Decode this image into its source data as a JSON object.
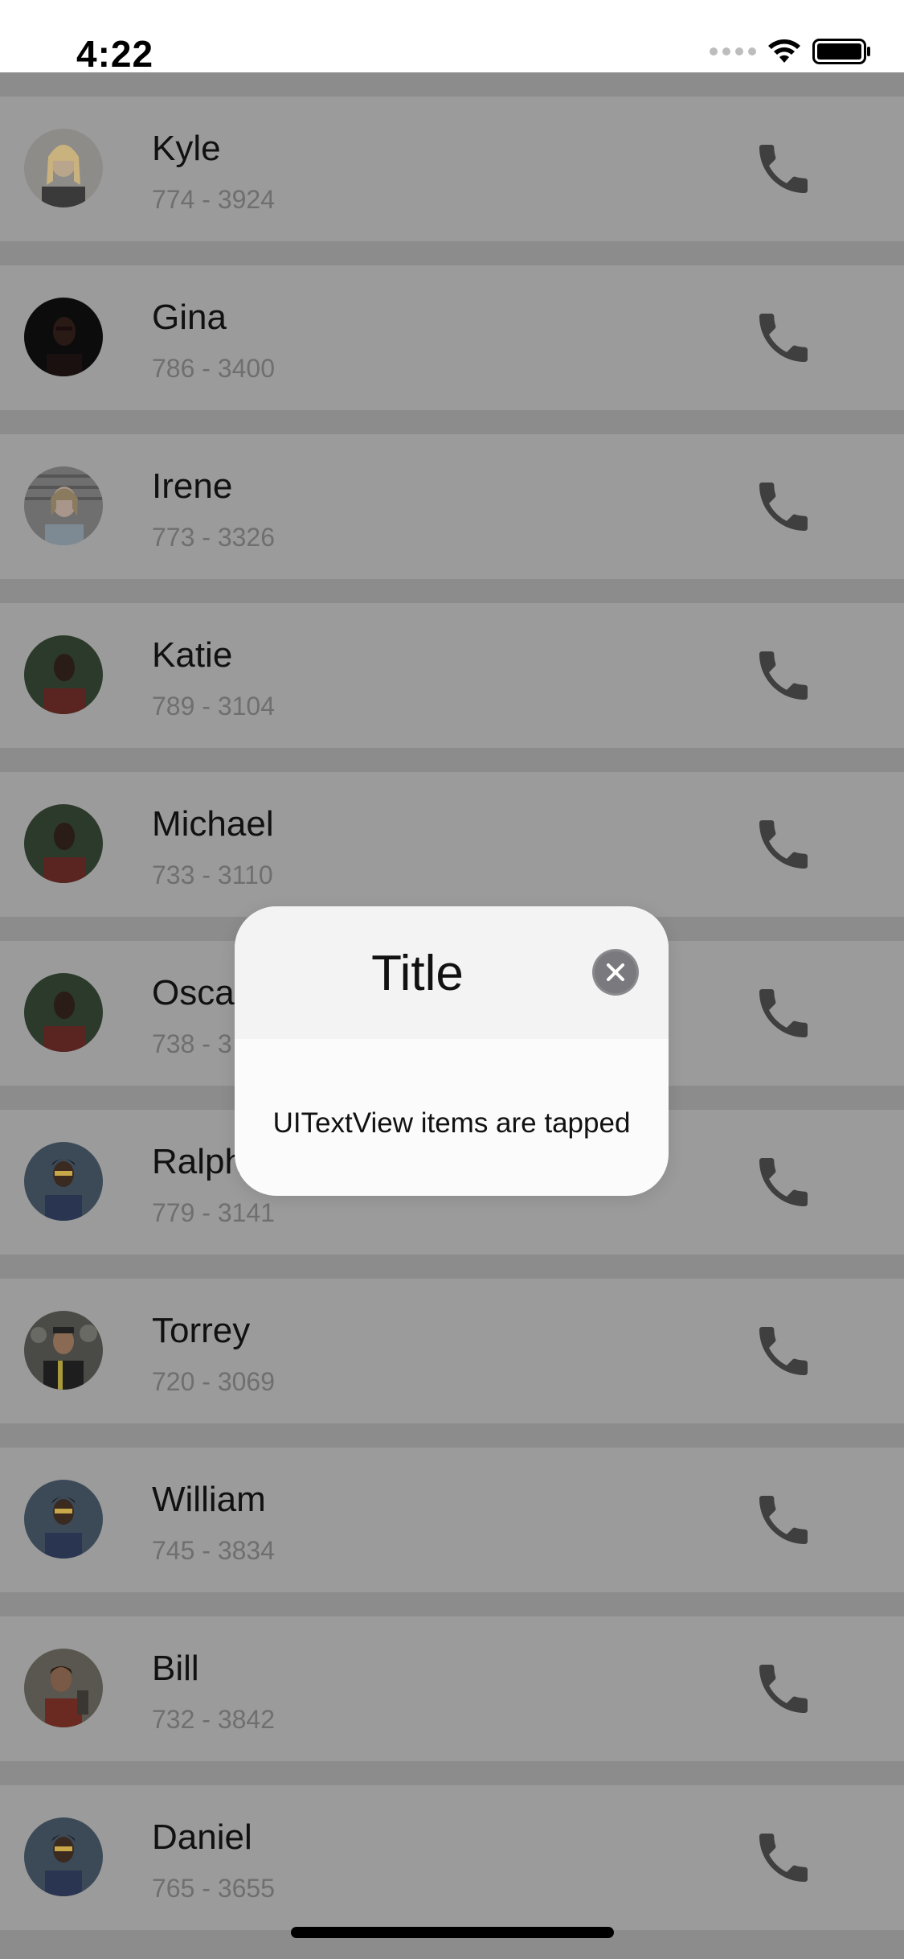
{
  "status_bar": {
    "time": "4:22"
  },
  "contacts": [
    {
      "name": "Kyle",
      "phone": "774 - 3924"
    },
    {
      "name": "Gina",
      "phone": "786 - 3400"
    },
    {
      "name": "Irene",
      "phone": "773 - 3326"
    },
    {
      "name": "Katie",
      "phone": "789 - 3104"
    },
    {
      "name": "Michael",
      "phone": "733 - 3110"
    },
    {
      "name": "Oscar",
      "phone": "738 - 3"
    },
    {
      "name": "Ralph",
      "phone": "779 - 3141"
    },
    {
      "name": "Torrey",
      "phone": "720 - 3069"
    },
    {
      "name": "William",
      "phone": "745 - 3834"
    },
    {
      "name": "Bill",
      "phone": "732 - 3842"
    },
    {
      "name": "Daniel",
      "phone": "765 - 3655"
    }
  ],
  "modal": {
    "title": "Title",
    "body": "UITextView items are tapped"
  },
  "icons": {
    "call": "phone-icon",
    "close": "close-icon",
    "wifi": "wifi-icon",
    "battery": "battery-icon"
  },
  "colors": {
    "overlay_background": "#8c8c8c",
    "row_background": "#9b9b9b",
    "icon_color": "#3f3f3f",
    "modal_header": "#f3f3f3",
    "modal_body": "#fbfbfb"
  }
}
